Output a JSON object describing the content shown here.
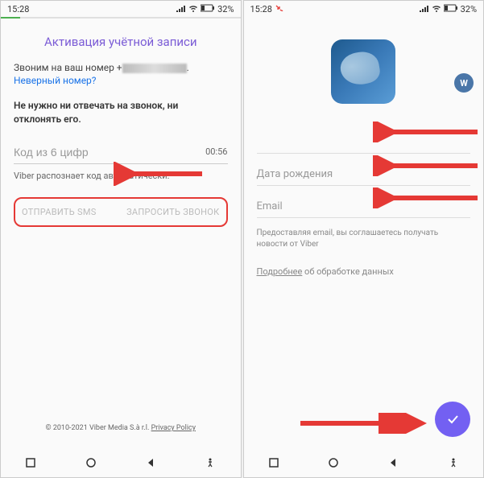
{
  "status": {
    "time": "15:28",
    "battery": "32%"
  },
  "left": {
    "title": "Активация учётной записи",
    "calling_prefix": "Звоним на ваш номер +",
    "wrong_number": "Неверный номер?",
    "instruction": "Не нужно ни отвечать на звонок, ни отклонять его.",
    "code_placeholder": "Код из 6 цифр",
    "timer": "00:56",
    "auto_detect": "Viber распознает код автоматически.",
    "send_sms": "ОТПРАВИТЬ SMS",
    "request_call": "ЗАПРОСИТЬ ЗВОНОК",
    "copyright": "© 2010-2021 Viber Media S.à r.l.",
    "privacy": "Privacy Policy"
  },
  "right": {
    "birthdate_placeholder": "Дата рождения",
    "email_placeholder": "Email",
    "disclaimer": "Предоставляя email, вы соглашаетесь получать новости от Viber",
    "more_link": "Подробнее",
    "more_text": " об обработке данных"
  }
}
